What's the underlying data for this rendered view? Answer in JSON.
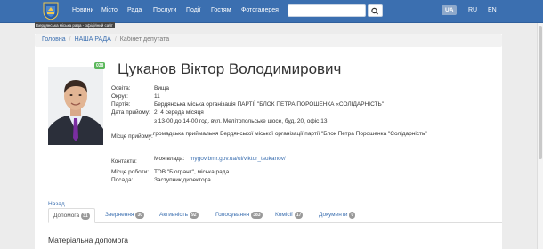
{
  "nav": {
    "links": [
      "Новини",
      "Місто",
      "Рада",
      "Послуги",
      "Події",
      "Гостям",
      "Фотогалерея"
    ],
    "languages": [
      "UA",
      "RU",
      "EN"
    ],
    "active_language": "UA",
    "logo_tooltip": "Бердянська міська рада - офіційний сайт"
  },
  "breadcrumb": {
    "items": [
      "Головна",
      "НАША РАДА"
    ],
    "current": "Кабінет депутата"
  },
  "profile": {
    "badge": "038",
    "name": "Цуканов Віктор Володимирович",
    "fields": {
      "education_label": "Освіта:",
      "education_value": "Вища",
      "district_label": "Округ:",
      "district_value": "11",
      "party_label": "Партія:",
      "party_value": "Бердянська міська організація ПАРТІЇ \"БЛОК ПЕТРА ПОРОШЕНКА «СОЛІДАРНІСТЬ\"",
      "reception_date_label": "Дата прийому:",
      "reception_date_value": "2, 4 середа місяця",
      "reception_time_value": "з 13-00 до 14-00 год. вул. Мелітопольське шосе, буд. 20, офіс 13,",
      "reception_place_label": "Місце прийому:",
      "reception_place_value": "громадська приймальня Бердянської міської організації партії \"Блок Петра Порошенка \"Солідарність\"",
      "contacts_label": "Контакти:",
      "my_power_label": "Моя влада:",
      "my_power_link": "mygov.bmr.gov.ua/ui/viktor_tsukanov/",
      "workplace_label": "Місце роботи:",
      "workplace_value": "ТОВ \"Біогрант\", міська рада",
      "position_label": "Посада:",
      "position_value": "Заступник директора"
    }
  },
  "back_link": "Назад",
  "tabs": [
    {
      "label": "Допомога",
      "count": "31"
    },
    {
      "label": "Звернення",
      "count": "30"
    },
    {
      "label": "Активність",
      "count": "92"
    },
    {
      "label": "Голосування",
      "count": "383"
    },
    {
      "label": "Комісії",
      "count": "17"
    },
    {
      "label": "Документи",
      "count": "0"
    }
  ],
  "section_title": "Матеріальна допомога",
  "colors": {
    "navbar": "#3b6fb0",
    "badge": "#5cb85c",
    "link": "#3b6fb0",
    "count_badge": "#999999"
  }
}
